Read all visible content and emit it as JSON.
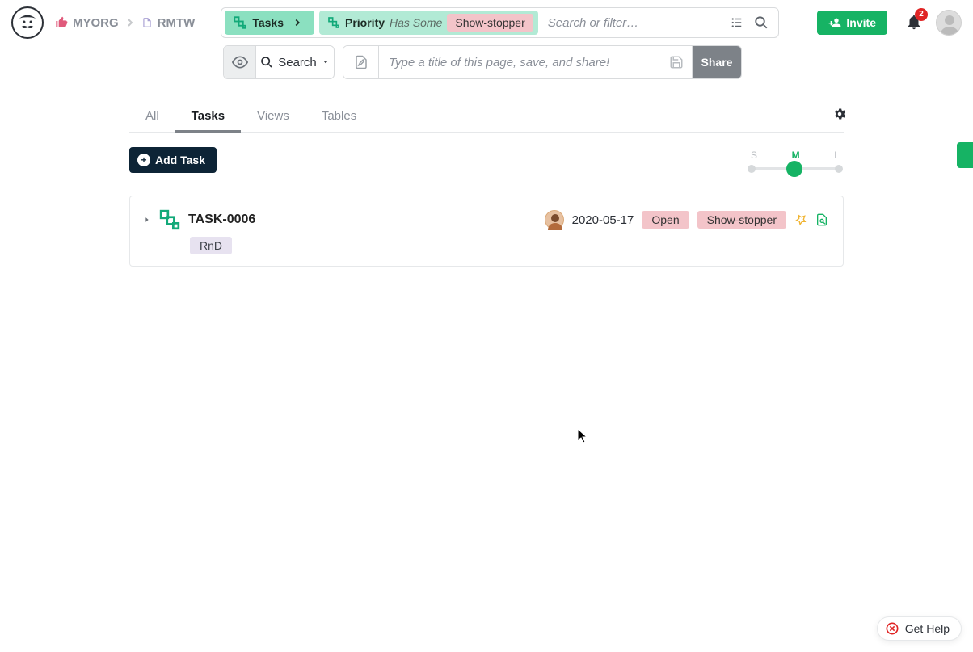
{
  "breadcrumb": {
    "org": "MYORG",
    "project": "RMTW"
  },
  "filter": {
    "tasks_chip": "Tasks",
    "priority_label": "Priority",
    "priority_op": "Has Some",
    "priority_value": "Show-stopper",
    "search_placeholder": "Search or filter…"
  },
  "toolbar": {
    "search_btn": "Search",
    "title_placeholder": "Type a title of this page, save, and share!",
    "share_btn": "Share"
  },
  "invite_btn": "Invite",
  "notifications_count": "2",
  "tabs": {
    "all": "All",
    "tasks": "Tasks",
    "views": "Views",
    "tables": "Tables"
  },
  "add_task_btn": "Add Task",
  "size_slider": {
    "s": "S",
    "m": "M",
    "l": "L"
  },
  "task": {
    "id": "TASK-0006",
    "date": "2020-05-17",
    "status": "Open",
    "priority": "Show-stopper",
    "tag": "RnD"
  },
  "help_btn": "Get Help"
}
